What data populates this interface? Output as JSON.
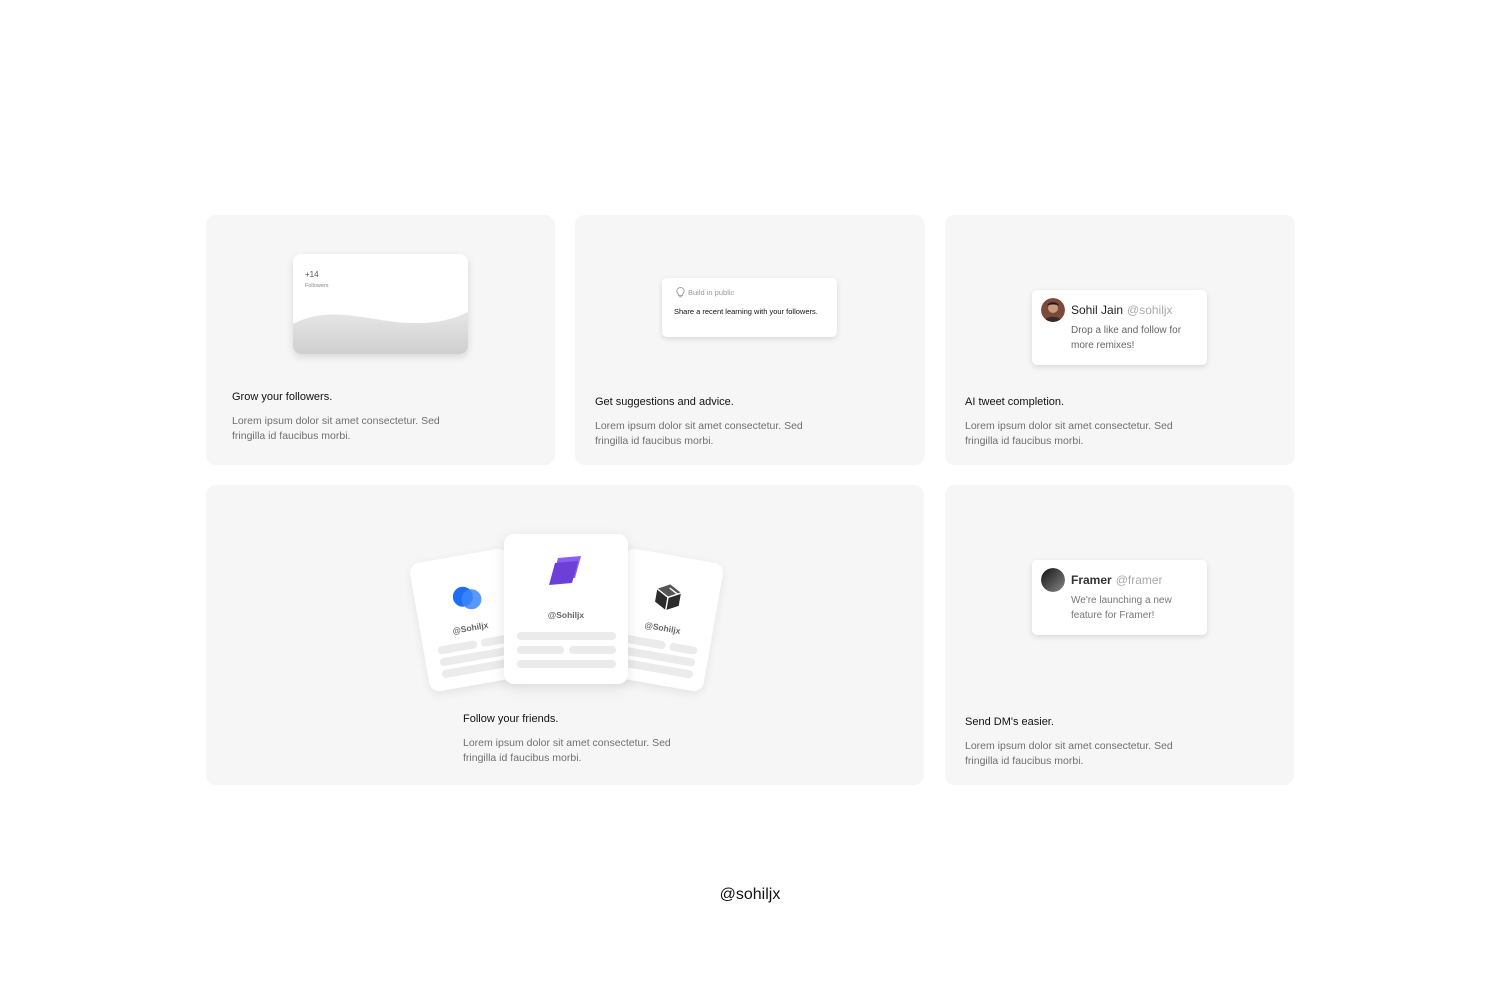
{
  "colors": {
    "card_bg": "#f6f6f6",
    "accent_blue": "#1d6ef5",
    "accent_purple": "#6c3fd6"
  },
  "cards": {
    "grow": {
      "title": "Grow your followers.",
      "description": "Lorem ipsum dolor sit amet consectetur. Sed fringilla id faucibus morbi.",
      "widget": {
        "count": "+14",
        "label": "Followers"
      }
    },
    "suggest": {
      "title": "Get suggestions and advice.",
      "description": "Lorem ipsum dolor sit amet consectetur. Sed fringilla id faucibus morbi.",
      "widget": {
        "tag": "Build in public",
        "prompt": "Share a recent learning with your followers.",
        "icon": "lightbulb-icon"
      }
    },
    "ai": {
      "title": "AI tweet completion.",
      "description": "Lorem ipsum dolor sit amet consectetur. Sed fringilla id faucibus morbi.",
      "tweet": {
        "name": "Sohil Jain",
        "handle": "@sohiljx",
        "body": "Drop a like and follow for more remixes!"
      }
    },
    "follow": {
      "title": "Follow your friends.",
      "description": "Lorem ipsum dolor sit amet consectetur. Sed fringilla id faucibus morbi.",
      "profiles": [
        {
          "handle": "@Sohiljx",
          "icon": "overlapping-circles-icon"
        },
        {
          "handle": "@Sohiljx",
          "icon": "stacked-layers-icon"
        },
        {
          "handle": "@Sohiljx",
          "icon": "cube-icon"
        }
      ]
    },
    "dm": {
      "title": "Send DM's easier.",
      "description": "Lorem ipsum dolor sit amet consectetur. Sed fringilla id faucibus morbi.",
      "tweet": {
        "name": "Framer",
        "handle": "@framer",
        "body": "We're launching a new feature for Framer!"
      }
    }
  },
  "footer": {
    "handle": "@sohiljx"
  }
}
